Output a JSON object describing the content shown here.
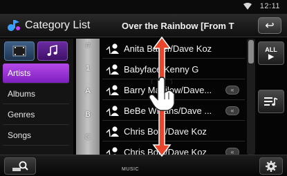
{
  "status": {
    "time": "12:11"
  },
  "header": {
    "title": "Category List",
    "now_playing": "Over the Rainbow [From T"
  },
  "left_panel": {
    "categories": [
      "Artists",
      "Albums",
      "Genres",
      "Songs"
    ],
    "selected": "Artists"
  },
  "index_bar": [
    "#",
    "1",
    "A",
    "B",
    "C"
  ],
  "list": {
    "items": [
      "Anita Baker/Dave Koz",
      "Babyface/Kenny G",
      "Barry Manilow/Dave...",
      "BeBe Winans/Dave ...",
      "Chris Botti/Dave Koz",
      "Chris Botti/Dave Koz"
    ]
  },
  "side_buttons": {
    "all_label": "ALL"
  },
  "bottom_bar": {
    "label": "MUSIC"
  },
  "colors": {
    "accent_purple": "#9b38d8",
    "index_bar": "#b0b0b0",
    "gesture_arrow": "#e8452a"
  }
}
